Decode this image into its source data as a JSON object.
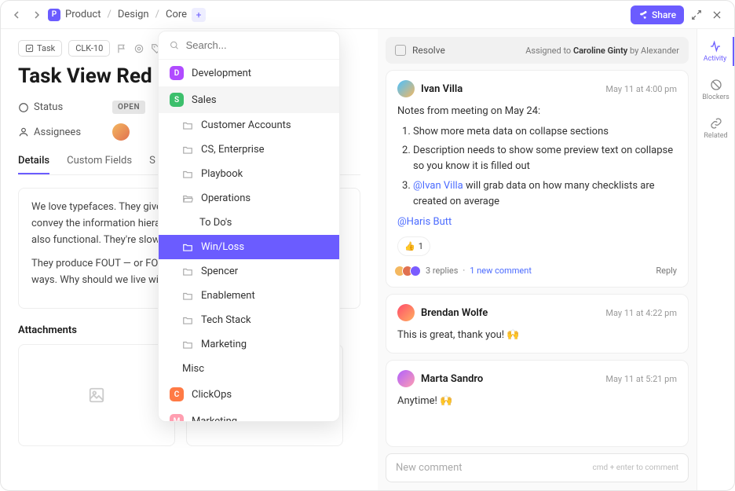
{
  "breadcrumb": {
    "icon": "P",
    "items": [
      "Product",
      "Design",
      "Core"
    ]
  },
  "share_label": "Share",
  "task": {
    "chip_label": "Task",
    "id": "CLK-10",
    "title": "Task View Red",
    "status_label": "Status",
    "status_value": "OPEN",
    "assignees_label": "Assignees"
  },
  "tabs": [
    "Details",
    "Custom Fields",
    "S"
  ],
  "description": {
    "p1": "We love typefaces. They give our applications a distinct voice. They convey the information hierarchy — and they can be slow. But they're also functional. They're slow.",
    "p2": "They produce FOUT — or FOIT — and we shouldn't have to choose ways. Why should we live with"
  },
  "attachments_label": "Attachments",
  "dropdown": {
    "search_placeholder": "Search...",
    "groups": [
      {
        "letter": "D",
        "color": "#b04bff",
        "label": "Development"
      },
      {
        "letter": "S",
        "color": "#3cbf6c",
        "label": "Sales"
      }
    ],
    "sales_items": [
      "Customer Accounts",
      "CS, Enterprise",
      "Playbook",
      "Operations"
    ],
    "todos_label": "To Do's",
    "winloss_label": "Win/Loss",
    "more_items": [
      "Spencer",
      "Enablement",
      "Tech Stack",
      "Marketing",
      "Misc"
    ],
    "extra": [
      {
        "letter": "C",
        "color": "#ff7a45",
        "label": "ClickOps"
      },
      {
        "letter": "M",
        "color": "#ff9eb0",
        "label": "Marketing"
      }
    ]
  },
  "resolve": {
    "label": "Resolve",
    "assigned_prefix": "Assigned to ",
    "assignee": "Caroline Ginty",
    "by_prefix": " by ",
    "by": "Alexander"
  },
  "comments": [
    {
      "author": "Ivan Villa",
      "time": "May 11 at 4:00 pm",
      "intro": "Notes from meeting on May 24:",
      "bullets": [
        "Show more meta data on collapse sections",
        "Description needs to show some preview text on collapse so you know it is filled out"
      ],
      "bullet3_mention": "@Ivan Villa",
      "bullet3_rest": " will grab data on how many checklists are created on average",
      "trailing_mention": "@Haris Butt",
      "react_emoji": "👍",
      "react_count": "1",
      "replies": "3 replies",
      "new_comment": "1 new comment",
      "reply_label": "Reply"
    },
    {
      "author": "Brendan Wolfe",
      "time": "May 11 at 4:22 pm",
      "body": "This is great, thank you! 🙌"
    },
    {
      "author": "Marta Sandro",
      "time": "May 11 at 5:21 pm",
      "body": "Anytime! 🙌"
    }
  ],
  "composer": {
    "placeholder": "New comment",
    "hint": "cmd + enter to comment"
  },
  "rail": {
    "activity": "Activity",
    "blockers": "Blockers",
    "related": "Related"
  }
}
